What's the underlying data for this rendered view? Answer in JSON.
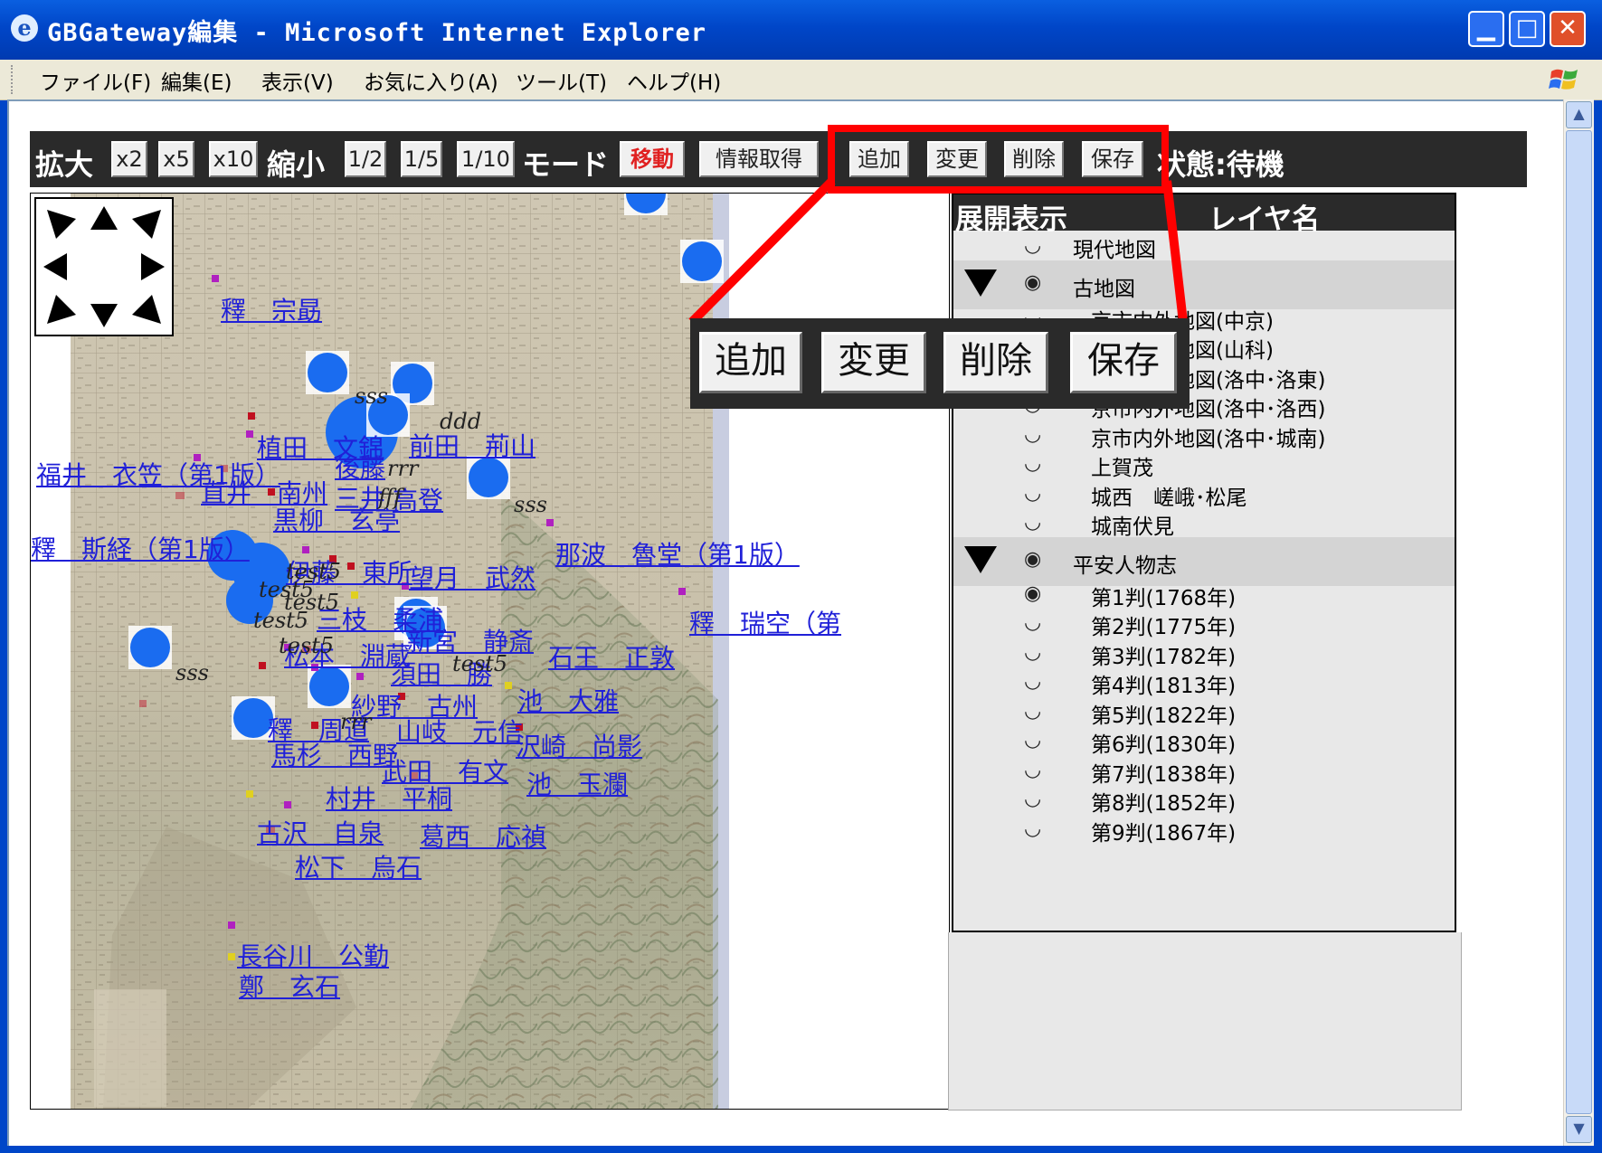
{
  "window": {
    "title": "GBGateway編集 - Microsoft Internet Explorer",
    "minimize": "▁",
    "maximize": "□",
    "close": "✕"
  },
  "menu": [
    "ファイル(F)",
    "編集(E)",
    "表示(V)",
    "お気に入り(A)",
    "ツール(T)",
    "ヘルプ(H)"
  ],
  "toolbar": {
    "zoom_in_label": "拡大",
    "zoom_in": [
      "x2",
      "x5",
      "x10"
    ],
    "zoom_out_label": "縮小",
    "zoom_out": [
      "1/2",
      "1/5",
      "1/10"
    ],
    "mode_label": "モード",
    "mode_move": "移動",
    "mode_info": "情報取得",
    "add": "追加",
    "change": "変更",
    "delete": "削除",
    "save": "保存",
    "status": "状態:待機"
  },
  "callout": {
    "add": "追加",
    "change": "変更",
    "delete": "削除",
    "save": "保存"
  },
  "layer_panel": {
    "col_expand": "展開表示",
    "col_name": "レイヤ名",
    "rows": [
      {
        "name": "現代地図",
        "visible": "◡",
        "group": false
      },
      {
        "name": "古地図",
        "visible": "◉",
        "group": true
      },
      {
        "name": "京市内外地図(中京)",
        "visible": "◡",
        "group": false
      },
      {
        "name": "京市内外地図(山科)",
        "visible": "◡",
        "group": false
      },
      {
        "name": "京市内外地図(洛中･洛東)",
        "visible": "◡",
        "group": false
      },
      {
        "name": "京市内外地図(洛中･洛西)",
        "visible": "◡",
        "group": false
      },
      {
        "name": "京市内外地図(洛中･城南)",
        "visible": "◡",
        "group": false
      },
      {
        "name": "上賀茂",
        "visible": "◡",
        "group": false
      },
      {
        "name": "城西　嵯峨･松尾",
        "visible": "◡",
        "group": false
      },
      {
        "name": "城南伏見",
        "visible": "◡",
        "group": false
      },
      {
        "name": "平安人物志",
        "visible": "◉",
        "group": true
      },
      {
        "name": "第1判(1768年)",
        "visible": "◉",
        "group": false
      },
      {
        "name": "第2判(1775年)",
        "visible": "◡",
        "group": false
      },
      {
        "name": "第3判(1782年)",
        "visible": "◡",
        "group": false
      },
      {
        "name": "第4判(1813年)",
        "visible": "◡",
        "group": false
      },
      {
        "name": "第5判(1822年)",
        "visible": "◡",
        "group": false
      },
      {
        "name": "第6判(1830年)",
        "visible": "◡",
        "group": false
      },
      {
        "name": "第7判(1838年)",
        "visible": "◡",
        "group": false
      },
      {
        "name": "第8判(1852年)",
        "visible": "◡",
        "group": false
      },
      {
        "name": "第9判(1867年)",
        "visible": "◡",
        "group": false
      }
    ]
  },
  "map": {
    "links": [
      "釋　宗勗",
      "植田　文錦",
      "前田　荊山",
      "福井　衣笠（第1版）",
      "直井　南州",
      "後藤",
      "三井",
      "高登",
      "黒柳　玄亭",
      "釋　斯経（第1版）",
      "那波　魯堂（第1版）",
      "伊藤　東所",
      "望月　武然",
      "三枝　柔浦",
      "釋　瑞空（第",
      "松本　淵蔵",
      "新宮　静斎",
      "石王　正敦",
      "須田　勝",
      "紗野　古州",
      "池　大雅",
      "釋　周道",
      "山岐　元信",
      "沢崎　尚影",
      "馬杉　西野",
      "武田　有文",
      "池　玉瀾",
      "村井　平桐",
      "古沢　自泉",
      "葛西　応禎",
      "松下　烏石",
      "長谷川　公勤",
      "鄭　玄石"
    ],
    "labels": [
      "sss",
      "ddd",
      "rrr",
      "fff",
      "sss",
      "test5",
      "test5",
      "test5",
      "test5",
      "sss",
      "test5",
      "test5",
      "rrr"
    ]
  },
  "colors": {
    "title_bar": "#0046c8",
    "toolbar_bg": "#2a2a2a",
    "highlight": "#ff0000",
    "link": "#2020d8",
    "marker_blue": "#1a6cf0"
  }
}
